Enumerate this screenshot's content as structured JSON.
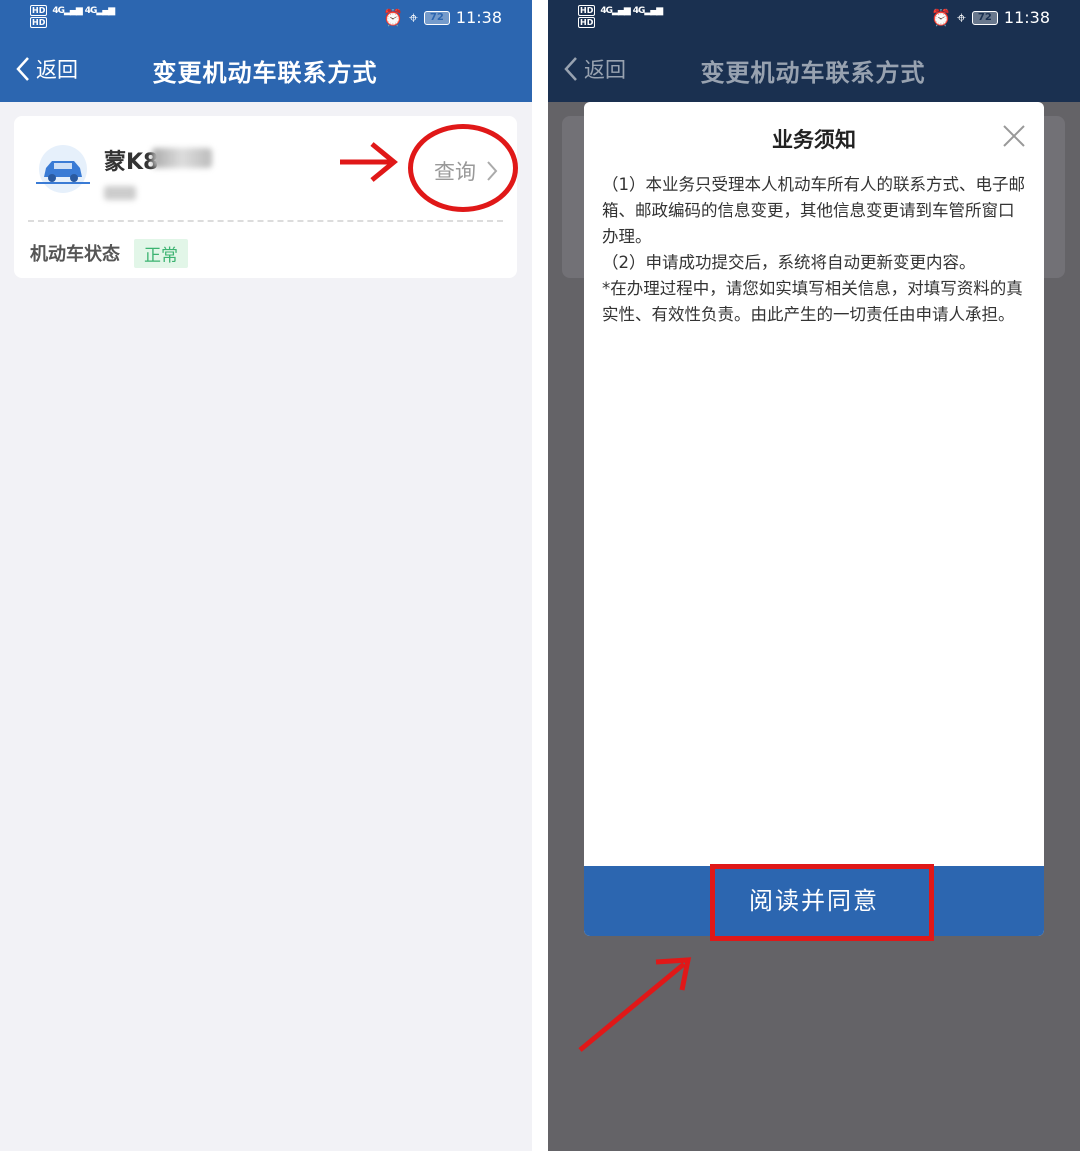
{
  "status_bar": {
    "hd1": "HD",
    "hd2": "HD",
    "net1": "4G",
    "net2": "4G",
    "battery": "72",
    "time": "11:38"
  },
  "header": {
    "back_label": "返回",
    "title": "变更机动车联系方式"
  },
  "vehicle_card": {
    "plate_prefix": "蒙K8",
    "query_label": "查询",
    "status_label": "机动车状态",
    "status_value": "正常"
  },
  "notice_modal": {
    "title": "业务须知",
    "paragraphs": [
      "（1）本业务只受理本人机动车所有人的联系方式、电子邮箱、邮政编码的信息变更，其他信息变更请到车管所窗口办理。",
      "（2）申请成功提交后，系统将自动更新变更内容。",
      "*在办理过程中，请您如实填写相关信息，对填写资料的真实性、有效性负责。由此产生的一切责任由申请人承担。"
    ],
    "agree_button": "阅读并同意"
  },
  "colors": {
    "header_blue": "#2c66b0",
    "annotation_red": "#e01818",
    "status_green": "#3cb371"
  }
}
